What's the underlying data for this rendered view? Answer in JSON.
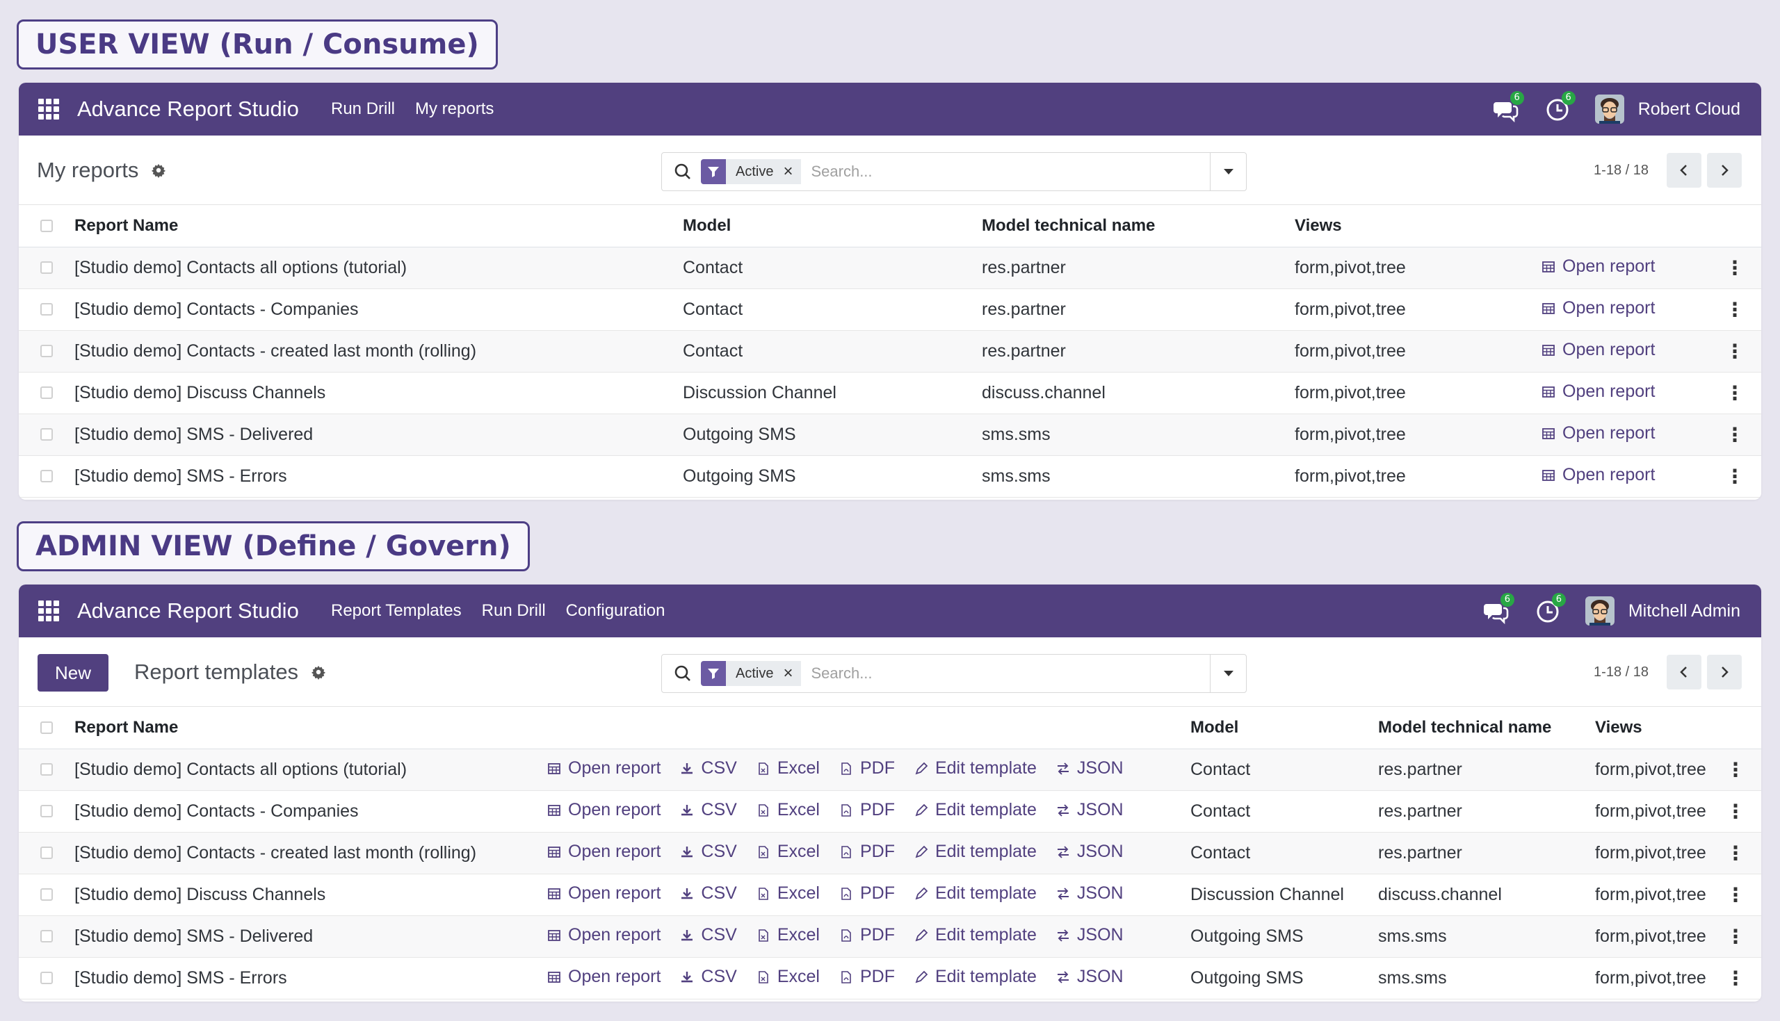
{
  "user_view": {
    "label": "USER VIEW (Run / Consume)",
    "navbar": {
      "brand": "Advance Report Studio",
      "menu": [
        "Run Drill",
        "My reports"
      ],
      "messages_badge": "6",
      "activities_badge": "6",
      "user": "Robert Cloud"
    },
    "title": "My reports",
    "search": {
      "facet": "Active",
      "placeholder": "Search..."
    },
    "pager": "1-18 / 18",
    "columns": [
      "Report Name",
      "Model",
      "Model technical name",
      "Views"
    ],
    "action_label": "Open report",
    "rows": [
      {
        "name": "[Studio demo] Contacts all options (tutorial)",
        "model": "Contact",
        "tech": "res.partner",
        "views": "form,pivot,tree"
      },
      {
        "name": "[Studio demo] Contacts - Companies",
        "model": "Contact",
        "tech": "res.partner",
        "views": "form,pivot,tree"
      },
      {
        "name": "[Studio demo] Contacts - created last month (rolling)",
        "model": "Contact",
        "tech": "res.partner",
        "views": "form,pivot,tree"
      },
      {
        "name": "[Studio demo] Discuss Channels",
        "model": "Discussion Channel",
        "tech": "discuss.channel",
        "views": "form,pivot,tree"
      },
      {
        "name": "[Studio demo] SMS - Delivered",
        "model": "Outgoing SMS",
        "tech": "sms.sms",
        "views": "form,pivot,tree"
      },
      {
        "name": "[Studio demo] SMS - Errors",
        "model": "Outgoing SMS",
        "tech": "sms.sms",
        "views": "form,pivot,tree"
      }
    ]
  },
  "admin_view": {
    "label": "ADMIN VIEW (Define / Govern)",
    "navbar": {
      "brand": "Advance Report Studio",
      "menu": [
        "Report Templates",
        "Run Drill",
        "Configuration"
      ],
      "messages_badge": "6",
      "activities_badge": "6",
      "user": "Mitchell Admin"
    },
    "new_button": "New",
    "title": "Report templates",
    "search": {
      "facet": "Active",
      "placeholder": "Search..."
    },
    "pager": "1-18 / 18",
    "columns": [
      "Report Name",
      "Model",
      "Model technical name",
      "Views"
    ],
    "actions": {
      "open": "Open report",
      "csv": "CSV",
      "excel": "Excel",
      "pdf": "PDF",
      "edit": "Edit template",
      "json": "JSON"
    },
    "rows": [
      {
        "name": "[Studio demo] Contacts all options (tutorial)",
        "model": "Contact",
        "tech": "res.partner",
        "views": "form,pivot,tree"
      },
      {
        "name": "[Studio demo] Contacts - Companies",
        "model": "Contact",
        "tech": "res.partner",
        "views": "form,pivot,tree"
      },
      {
        "name": "[Studio demo] Contacts - created last month (rolling)",
        "model": "Contact",
        "tech": "res.partner",
        "views": "form,pivot,tree"
      },
      {
        "name": "[Studio demo] Discuss Channels",
        "model": "Discussion Channel",
        "tech": "discuss.channel",
        "views": "form,pivot,tree"
      },
      {
        "name": "[Studio demo] SMS - Delivered",
        "model": "Outgoing SMS",
        "tech": "sms.sms",
        "views": "form,pivot,tree"
      },
      {
        "name": "[Studio demo] SMS - Errors",
        "model": "Outgoing SMS",
        "tech": "sms.sms",
        "views": "form,pivot,tree"
      }
    ]
  },
  "colors": {
    "navbar": "#51407f",
    "accent": "#51407f",
    "badge": "#28a745",
    "background": "#e7e5ef"
  }
}
